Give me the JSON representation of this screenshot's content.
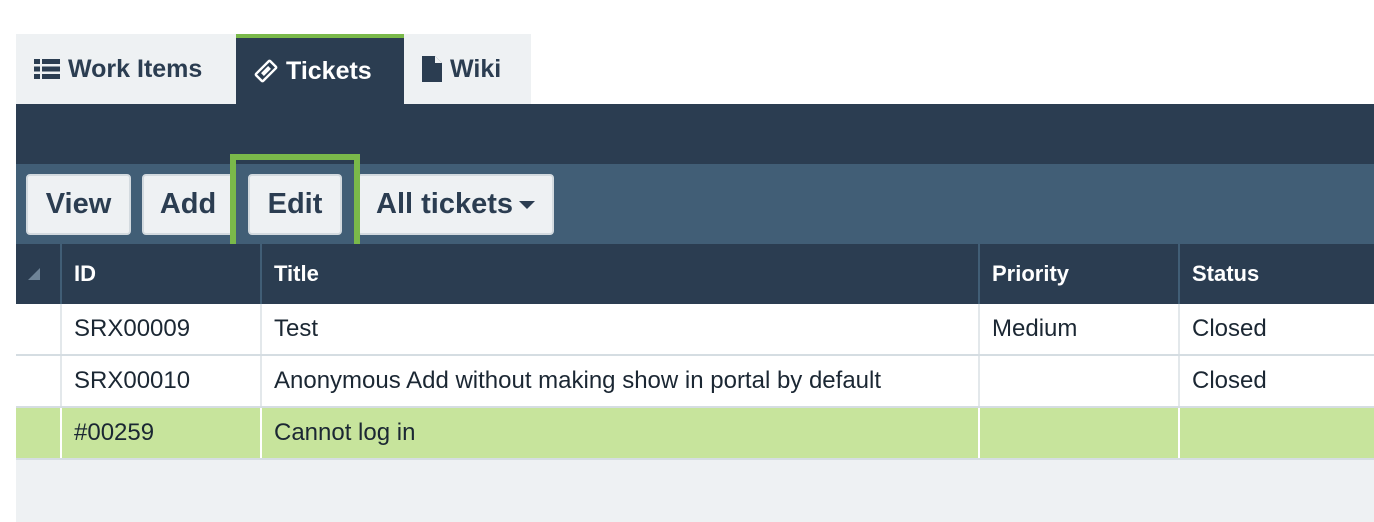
{
  "tabs": [
    {
      "label": "Work Items",
      "icon": "list-icon"
    },
    {
      "label": "Tickets",
      "icon": "ticket-icon"
    },
    {
      "label": "Wiki",
      "icon": "document-icon"
    }
  ],
  "toolbar": {
    "view_label": "View",
    "add_label": "Add",
    "edit_label": "Edit",
    "filter_label": "All tickets"
  },
  "table": {
    "columns": [
      "ID",
      "Title",
      "Priority",
      "Status"
    ],
    "rows": [
      {
        "id": "SRX00009",
        "title": "Test",
        "priority": "Medium",
        "status": "Closed"
      },
      {
        "id": "SRX00010",
        "title": "Anonymous Add without making show in portal by default",
        "priority": "",
        "status": "Closed"
      },
      {
        "id": "#00259",
        "title": "Cannot log in",
        "priority": "",
        "status": "",
        "selected": true
      }
    ]
  },
  "colors": {
    "accent": "#7ab94a",
    "header_dark": "#2b3d51",
    "toolbar": "#415e76",
    "selected_row": "#c7e49c"
  }
}
